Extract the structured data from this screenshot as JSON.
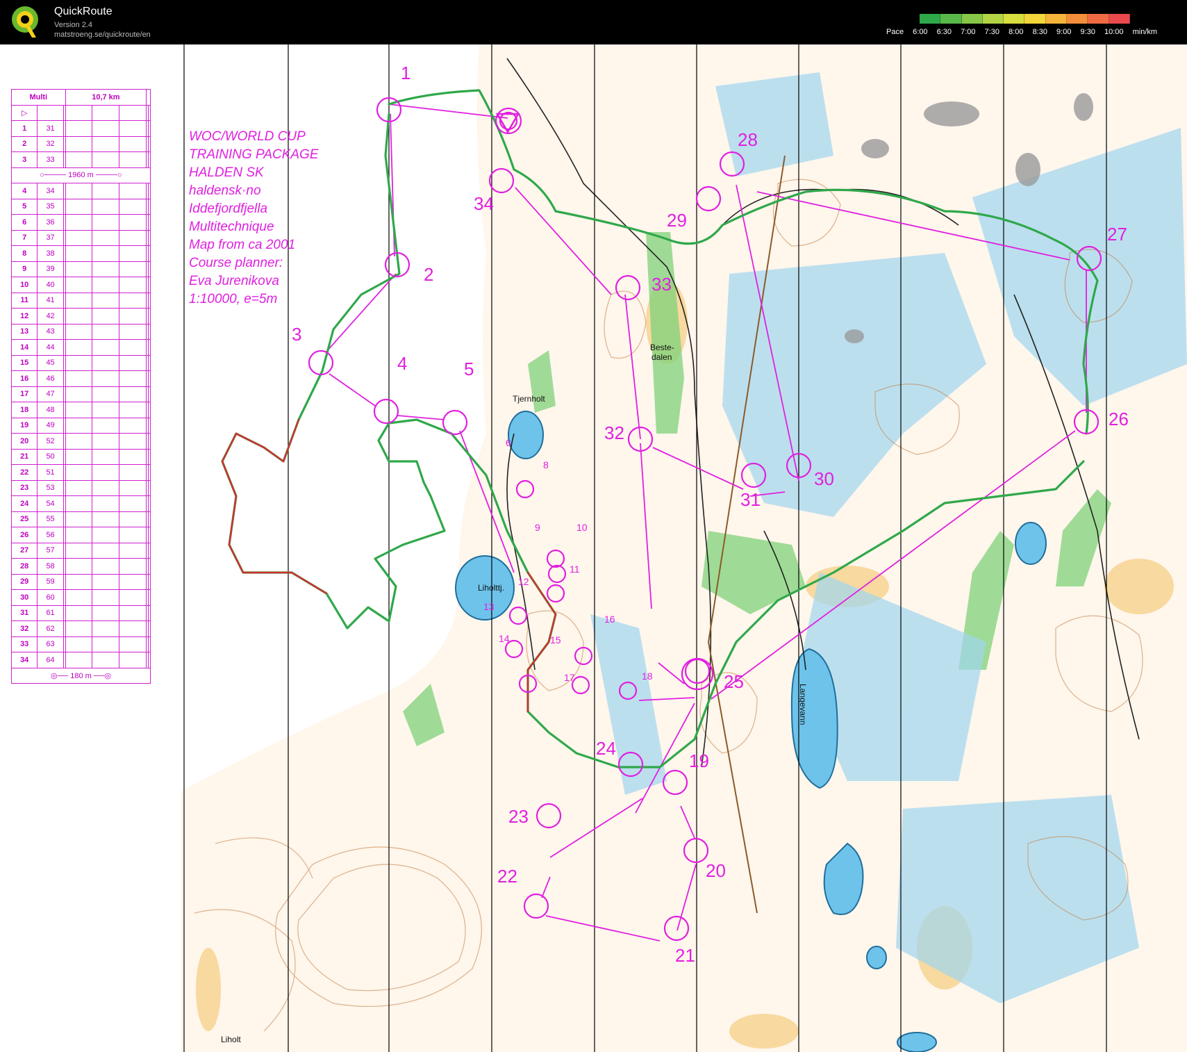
{
  "app": {
    "name": "QuickRoute",
    "version": "Version 2.4",
    "url": "matstroeng.se/quickroute/en"
  },
  "pace_legend": {
    "label": "Pace",
    "ticks": [
      "6:00",
      "6:30",
      "7:00",
      "7:30",
      "8:00",
      "8:30",
      "9:00",
      "9:30",
      "10:00"
    ],
    "unit": "min/km",
    "colors": [
      "#2fa84a",
      "#58b84a",
      "#86c648",
      "#b3d444",
      "#d8de3e",
      "#f2d63a",
      "#f6b43a",
      "#f48e3c",
      "#f06a44",
      "#ea4a4e"
    ]
  },
  "course_info": {
    "lines": [
      "WOC/WORLD CUP",
      "TRAINING PACKAGE",
      "HALDEN SK",
      "haldensk·no",
      "Iddefjordfjella",
      "Multitechnique",
      "Map from ca 2001",
      "Course planner:",
      "Eva Jurenikova",
      "1:10000, e=5m"
    ]
  },
  "description_sheet": {
    "header": [
      "Multi",
      "10,7 km"
    ],
    "leg1": "1960 m",
    "finish": "180 m",
    "controls": [
      [
        "1",
        "31"
      ],
      [
        "2",
        "32"
      ],
      [
        "3",
        "33"
      ],
      [
        "4",
        "34"
      ],
      [
        "5",
        "35"
      ],
      [
        "6",
        "36"
      ],
      [
        "7",
        "37"
      ],
      [
        "8",
        "38"
      ],
      [
        "9",
        "39"
      ],
      [
        "10",
        "40"
      ],
      [
        "11",
        "41"
      ],
      [
        "12",
        "42"
      ],
      [
        "13",
        "43"
      ],
      [
        "14",
        "44"
      ],
      [
        "15",
        "45"
      ],
      [
        "16",
        "46"
      ],
      [
        "17",
        "47"
      ],
      [
        "18",
        "48"
      ],
      [
        "19",
        "49"
      ],
      [
        "20",
        "52"
      ],
      [
        "21",
        "50"
      ],
      [
        "22",
        "51"
      ],
      [
        "23",
        "53"
      ],
      [
        "24",
        "54"
      ],
      [
        "25",
        "55"
      ],
      [
        "26",
        "56"
      ],
      [
        "27",
        "57"
      ],
      [
        "28",
        "58"
      ],
      [
        "29",
        "59"
      ],
      [
        "30",
        "60"
      ],
      [
        "31",
        "61"
      ],
      [
        "32",
        "62"
      ],
      [
        "33",
        "63"
      ],
      [
        "34",
        "64"
      ]
    ]
  },
  "map_labels": {
    "tjernholt": "Tjernholt",
    "liholttj": "Liholttj.",
    "beste": "Beste-",
    "dalen": "dalen",
    "langevann": "Langevann",
    "liholt": "Liholt"
  },
  "control_numbers": [
    "1",
    "2",
    "3",
    "4",
    "5",
    "6",
    "8",
    "9",
    "10",
    "11",
    "12",
    "13",
    "14",
    "15",
    "16",
    "17",
    "18",
    "19",
    "20",
    "21",
    "22",
    "23",
    "24",
    "25",
    "26",
    "27",
    "28",
    "29",
    "30",
    "31",
    "32",
    "33",
    "34"
  ],
  "colors": {
    "course": "#e020e0",
    "route_good": "#2fa84a",
    "route_slow": "#d03030"
  }
}
